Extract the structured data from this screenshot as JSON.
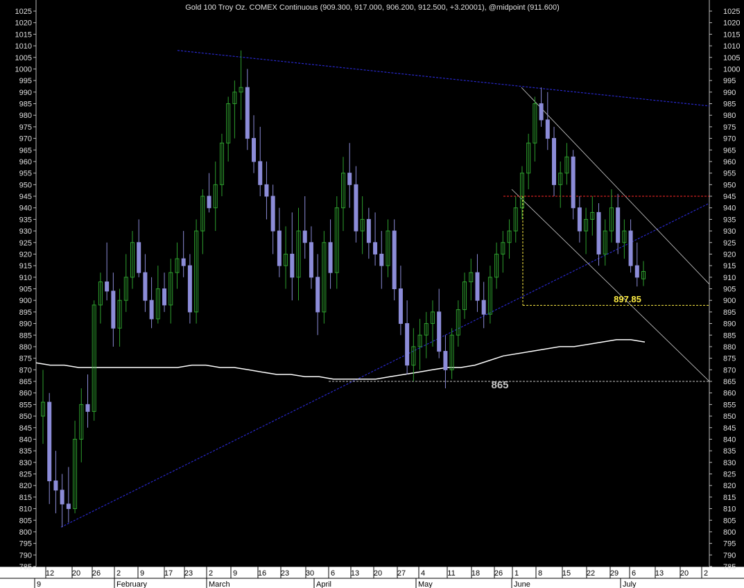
{
  "chart_data": {
    "type": "candlestick",
    "title": "Gold 100 Troy Oz. COMEX Continuous (909.300, 917.000, 906.200, 912.500, +3.20001), @midpoint (911.600)",
    "ylim": [
      785,
      1028
    ],
    "y_ticks": [
      785,
      790,
      795,
      800,
      805,
      810,
      815,
      820,
      825,
      830,
      835,
      840,
      845,
      850,
      855,
      860,
      865,
      870,
      875,
      880,
      885,
      890,
      895,
      900,
      905,
      910,
      915,
      920,
      925,
      930,
      935,
      940,
      945,
      950,
      955,
      960,
      965,
      970,
      975,
      980,
      985,
      990,
      995,
      1000,
      1005,
      1010,
      1015,
      1020,
      1025
    ],
    "x_day_ticks": [
      "12",
      "20",
      "26",
      "2",
      "9",
      "17",
      "23",
      "2",
      "9",
      "16",
      "23",
      "30",
      "6",
      "13",
      "20",
      "27",
      "4",
      "11",
      "18",
      "26",
      "1",
      "8",
      "15",
      "22",
      "29",
      "6",
      "13",
      "20",
      "2"
    ],
    "x_month_labels": [
      "9",
      "February",
      "March",
      "April",
      "May",
      "June",
      "July"
    ],
    "annotations": [
      "897.85",
      "865"
    ],
    "series": [
      {
        "values": [
          [
            850,
            870,
            838,
            856
          ],
          [
            856,
            860,
            812,
            822
          ],
          [
            822,
            835,
            808,
            818
          ],
          [
            818,
            825,
            802,
            812
          ],
          [
            812,
            828,
            804,
            810
          ],
          [
            810,
            848,
            808,
            840
          ],
          [
            840,
            862,
            830,
            855
          ],
          [
            855,
            868,
            845,
            852
          ],
          [
            852,
            900,
            848,
            898
          ],
          [
            898,
            912,
            890,
            908
          ],
          [
            908,
            925,
            900,
            904
          ],
          [
            904,
            912,
            880,
            888
          ],
          [
            888,
            905,
            880,
            900
          ],
          [
            900,
            920,
            895,
            910
          ],
          [
            910,
            930,
            905,
            925
          ],
          [
            925,
            935,
            910,
            912
          ],
          [
            912,
            920,
            895,
            900
          ],
          [
            900,
            910,
            888,
            892
          ],
          [
            892,
            915,
            890,
            905
          ],
          [
            905,
            912,
            895,
            898
          ],
          [
            898,
            918,
            890,
            912
          ],
          [
            912,
            925,
            905,
            918
          ],
          [
            918,
            930,
            910,
            915
          ],
          [
            915,
            920,
            890,
            895
          ],
          [
            895,
            935,
            890,
            930
          ],
          [
            930,
            948,
            920,
            945
          ],
          [
            945,
            955,
            938,
            940
          ],
          [
            940,
            960,
            930,
            950
          ],
          [
            950,
            972,
            945,
            968
          ],
          [
            968,
            988,
            960,
            985
          ],
          [
            985,
            995,
            970,
            990
          ],
          [
            990,
            1008,
            978,
            992
          ],
          [
            992,
            1000,
            965,
            970
          ],
          [
            970,
            980,
            955,
            960
          ],
          [
            960,
            975,
            945,
            950
          ],
          [
            950,
            960,
            935,
            945
          ],
          [
            945,
            950,
            920,
            930
          ],
          [
            930,
            940,
            910,
            915
          ],
          [
            915,
            932,
            905,
            920
          ],
          [
            920,
            938,
            900,
            910
          ],
          [
            910,
            940,
            900,
            930
          ],
          [
            930,
            945,
            918,
            925
          ],
          [
            925,
            932,
            905,
            910
          ],
          [
            910,
            920,
            885,
            895
          ],
          [
            895,
            930,
            890,
            925
          ],
          [
            925,
            935,
            905,
            912
          ],
          [
            912,
            945,
            905,
            940
          ],
          [
            940,
            962,
            930,
            955
          ],
          [
            955,
            968,
            940,
            950
          ],
          [
            950,
            958,
            925,
            930
          ],
          [
            930,
            945,
            920,
            935
          ],
          [
            935,
            940,
            918,
            925
          ],
          [
            925,
            938,
            915,
            920
          ],
          [
            920,
            930,
            905,
            915
          ],
          [
            915,
            935,
            910,
            930
          ],
          [
            930,
            935,
            900,
            905
          ],
          [
            905,
            915,
            885,
            890
          ],
          [
            890,
            900,
            868,
            872
          ],
          [
            872,
            888,
            865,
            880
          ],
          [
            880,
            892,
            870,
            885
          ],
          [
            885,
            895,
            875,
            890
          ],
          [
            890,
            900,
            880,
            895
          ],
          [
            895,
            905,
            875,
            878
          ],
          [
            878,
            885,
            862,
            870
          ],
          [
            870,
            888,
            866,
            885
          ],
          [
            885,
            900,
            880,
            896
          ],
          [
            896,
            912,
            892,
            908
          ],
          [
            908,
            918,
            900,
            912
          ],
          [
            912,
            920,
            895,
            900
          ],
          [
            900,
            908,
            888,
            894
          ],
          [
            894,
            915,
            890,
            910
          ],
          [
            910,
            925,
            905,
            920
          ],
          [
            920,
            930,
            912,
            925
          ],
          [
            925,
            935,
            918,
            930
          ],
          [
            930,
            945,
            925,
            940
          ],
          [
            940,
            958,
            935,
            955
          ],
          [
            955,
            972,
            948,
            968
          ],
          [
            968,
            988,
            960,
            985
          ],
          [
            985,
            992,
            975,
            978
          ],
          [
            978,
            990,
            965,
            970
          ],
          [
            970,
            975,
            945,
            950
          ],
          [
            950,
            960,
            940,
            955
          ],
          [
            955,
            968,
            950,
            962
          ],
          [
            962,
            965,
            935,
            940
          ],
          [
            940,
            945,
            925,
            930
          ],
          [
            930,
            940,
            920,
            935
          ],
          [
            935,
            945,
            928,
            938
          ],
          [
            938,
            942,
            915,
            920
          ],
          [
            920,
            935,
            915,
            930
          ],
          [
            930,
            948,
            925,
            940
          ],
          [
            940,
            946,
            920,
            925
          ],
          [
            925,
            935,
            918,
            930
          ],
          [
            930,
            935,
            912,
            915
          ],
          [
            915,
            925,
            906,
            910
          ],
          [
            909.3,
            917,
            906.2,
            912.5
          ]
        ]
      },
      {
        "name": "moving average",
        "values": [
          873,
          872,
          872,
          871,
          871,
          871,
          871,
          871,
          871,
          871,
          871,
          872,
          872,
          871,
          871,
          870,
          869,
          868,
          868,
          867,
          867,
          866,
          866,
          866,
          866,
          867,
          868,
          869,
          870,
          871,
          871,
          872,
          874,
          876,
          877,
          878,
          879,
          880,
          880,
          881,
          882,
          883,
          883,
          882
        ]
      }
    ],
    "trendlines": [
      {
        "from": [
          "12",
          802
        ],
        "to": [
          "end",
          942
        ]
      },
      {
        "from": [
          "17",
          1008
        ],
        "to": [
          "end",
          984
        ]
      },
      {
        "from": [
          "1",
          992
        ],
        "to": [
          "end",
          907
        ]
      },
      {
        "from": [
          "1",
          948
        ],
        "to": [
          "end",
          865
        ]
      }
    ],
    "levels": [
      945,
      897.85,
      865
    ],
    "colors": {
      "background": "#000000",
      "text": "#e0e0e0",
      "axis": "#bcbcbc",
      "up": "#2ea02e",
      "down": "#8c8cd8",
      "trend": "#2828cc",
      "channel": "#d0d0d0",
      "resistance": "#ff2828",
      "level_highlight": "#ffee44",
      "support": "#c8c8c8",
      "moving_average": "#ffffff",
      "annotation_865": "#c8c8c8"
    }
  }
}
